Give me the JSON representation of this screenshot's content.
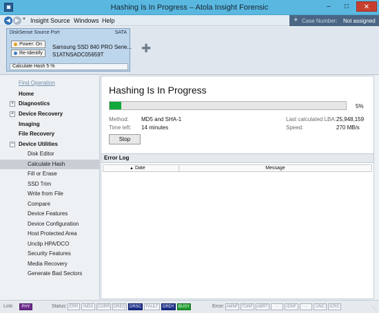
{
  "window": {
    "title": "Hashing Is In Progress – Atola Insight Forensic",
    "minimize": "–",
    "maximize": "□",
    "close": "✕"
  },
  "menu": {
    "items": [
      "Insight",
      "Source",
      "Windows",
      "Help"
    ],
    "case_label": "Case Number:",
    "case_value": "Not assigned"
  },
  "device_card": {
    "port": "DiskSense Source Port",
    "interface": "SATA",
    "power_label": "Power: On",
    "reidentify_label": "Re-Identify",
    "model": "Samsung SSD 840 PRO Serie...",
    "serial": "S1ATNSADC05659T",
    "status": "Calculate Hash  5 %"
  },
  "sidebar": {
    "find_operation": "Find Operation",
    "items": [
      {
        "label": "Home",
        "level": "top"
      },
      {
        "label": "Diagnostics",
        "level": "top",
        "toggle": "+"
      },
      {
        "label": "Device Recovery",
        "level": "top",
        "toggle": "+"
      },
      {
        "label": "Imaging",
        "level": "top"
      },
      {
        "label": "File Recovery",
        "level": "top"
      },
      {
        "label": "Device Utilities",
        "level": "top",
        "toggle": "−"
      },
      {
        "label": "Disk Editor",
        "level": "sub"
      },
      {
        "label": "Calculate Hash",
        "level": "sub",
        "active": true
      },
      {
        "label": "Fill or Erase",
        "level": "sub"
      },
      {
        "label": "SSD Trim",
        "level": "sub"
      },
      {
        "label": "Write from File",
        "level": "sub"
      },
      {
        "label": "Compare",
        "level": "sub"
      },
      {
        "label": "Device Features",
        "level": "sub"
      },
      {
        "label": "Device Configuration",
        "level": "sub"
      },
      {
        "label": "Host Protected Area",
        "level": "sub"
      },
      {
        "label": "Unclip HPA/DCO",
        "level": "sub"
      },
      {
        "label": "Security Features",
        "level": "sub"
      },
      {
        "label": "Media Recovery",
        "level": "sub"
      },
      {
        "label": "Generate Bad Sectors",
        "level": "sub"
      }
    ]
  },
  "operation": {
    "title": "Hashing Is In Progress",
    "progress_percent": 5,
    "progress_label": "5%",
    "method_label": "Method:",
    "method_value": "MD5 and SHA-1",
    "time_left_label": "Time left:",
    "time_left_value": "14 minutes",
    "last_lba_label": "Last calculated LBA:",
    "last_lba_value": "25,948,159",
    "speed_label": "Speed:",
    "speed_value": "270 MB/s",
    "stop_label": "Stop"
  },
  "error_log": {
    "title": "Error Log",
    "columns": [
      "Date",
      "Message"
    ],
    "rows": []
  },
  "statusbar": {
    "link_label": "Link:",
    "link_badges": [
      {
        "text": "PHY",
        "state": "purple"
      }
    ],
    "status_label": "Status:",
    "status_badges": [
      {
        "text": "ERR",
        "state": "off"
      },
      {
        "text": "INDX",
        "state": "off"
      },
      {
        "text": "CORR",
        "state": "off"
      },
      {
        "text": "DREQ",
        "state": "off"
      },
      {
        "text": "DRSC",
        "state": "blue"
      },
      {
        "text": "FAULT",
        "state": "off"
      },
      {
        "text": "DRDY",
        "state": "blue"
      },
      {
        "text": "BUSY",
        "state": "green"
      }
    ],
    "error_label": "Error:",
    "error_badges": [
      {
        "text": "AMNF",
        "state": "off"
      },
      {
        "text": "TONF",
        "state": "off"
      },
      {
        "text": "ABRT",
        "state": "off"
      },
      {
        "text": "-",
        "state": "off"
      },
      {
        "text": "IDNF",
        "state": "off"
      },
      {
        "text": "-",
        "state": "off"
      },
      {
        "text": "UNC",
        "state": "off"
      },
      {
        "text": "ICRC",
        "state": "off"
      }
    ]
  },
  "colors": {
    "titlebar": "#5ab8e0",
    "progress_fill": "#13a83a",
    "badge_purple": "#6a2a8c",
    "badge_blue": "#1c2f8a",
    "badge_green": "#1d9a2c"
  }
}
